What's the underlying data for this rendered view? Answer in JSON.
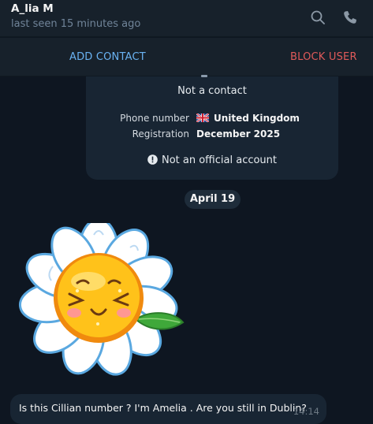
{
  "header": {
    "name": "A_lia M",
    "status": "last seen 15 minutes ago",
    "icons": [
      "search-icon",
      "phone-icon"
    ]
  },
  "actions": {
    "add_contact": "ADD CONTACT",
    "block_user": "BLOCK USER"
  },
  "info_card": {
    "contact_status": "Not a contact",
    "phone_label": "Phone number",
    "phone_value": "United Kingdom",
    "phone_flag": "uk-flag-icon",
    "registration_label": "Registration",
    "registration_value": "December 2025",
    "official_note": "Not an official account"
  },
  "date_separator": "April 19",
  "message": {
    "text": "Is this Cillian number ? I'm Amelia . Are you still in Dublin?",
    "time": "14:14"
  },
  "colors": {
    "background": "#0e1621",
    "panel": "#17212b",
    "accent": "#6ab3f3",
    "danger": "#e05a5a",
    "muted": "#708499"
  }
}
